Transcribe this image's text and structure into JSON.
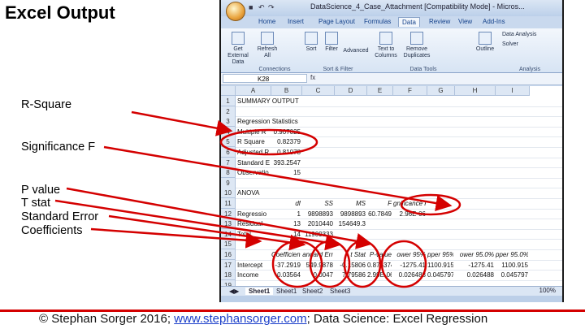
{
  "slide": {
    "title": "Excel Output",
    "labels": [
      "R-Square",
      "Significance F",
      "P value",
      "T stat",
      "Standard Error",
      "Coefficients"
    ],
    "footer_prefix": "© Stephan Sorger 2016; ",
    "footer_link": "www.stephansorger.com",
    "footer_suffix": "; Data Science: Excel Regression",
    "accent": "#d40000"
  },
  "excel": {
    "window_title": "DataScience_4_Case_Attachment [Compatibility Mode] - Micros...",
    "tabs": [
      "Home",
      "Insert",
      "Page Layout",
      "Formulas",
      "Data",
      "Review",
      "View",
      "Add-Ins"
    ],
    "active_tab": "Data",
    "ribbon": {
      "buttons": [
        "Get External Data",
        "Refresh All",
        "Sort",
        "Filter",
        "Advanced",
        "Text to Columns",
        "Remove Duplicates",
        "Outline",
        "Data Analysis",
        "Solver"
      ],
      "groups": [
        "Connections",
        "Sort & Filter",
        "Data Tools",
        "Analysis"
      ]
    },
    "name_box": "K28",
    "fx": "fx",
    "columns": [
      "A",
      "B",
      "C",
      "D",
      "E",
      "F",
      "G",
      "H",
      "I"
    ],
    "rows": [
      "1",
      "2",
      "3",
      "4",
      "5",
      "6",
      "7",
      "8",
      "9",
      "10",
      "11",
      "12",
      "13",
      "14",
      "15",
      "16",
      "17",
      "18",
      "19"
    ],
    "summary": {
      "title": "SUMMARY OUTPUT",
      "reg_stats": "Regression Statistics",
      "stats": [
        {
          "label": "Multiple R",
          "value": "0.907025"
        },
        {
          "label": "R Square",
          "value": "0.82379"
        },
        {
          "label": "Adjusted R",
          "value": "0.81078"
        },
        {
          "label": "Standard E",
          "value": "393.2547"
        },
        {
          "label": "Observatio",
          "value": "15"
        }
      ]
    },
    "anova": {
      "title": "ANOVA",
      "headers": [
        "df",
        "SS",
        "MS",
        "F",
        "gnificance F"
      ],
      "rows": [
        {
          "label": "Regressio",
          "df": "1",
          "ss": "9898893",
          "ms": "9898893",
          "f": "60.7849",
          "sig": "2.96E-06"
        },
        {
          "label": "Residual",
          "df": "13",
          "ss": "2010440",
          "ms": "154649.3",
          "f": "",
          "sig": ""
        },
        {
          "label": "Total",
          "df": "14",
          "ss": "11909333",
          "ms": "",
          "f": "",
          "sig": ""
        }
      ]
    },
    "coef": {
      "headers": [
        "Coefficients",
        "andard Err",
        "t Stat",
        "P-value",
        "ower 95%",
        "pper 95%",
        "ower 95.0%",
        "pper 95.0%"
      ],
      "rows": [
        {
          "label": "Intercept",
          "vals": [
            "-37.2919",
            "549.9878",
            "-0.15806",
            "0.876374",
            "-1275.41",
            "1100.915",
            "-1275.41",
            "1100.915"
          ]
        },
        {
          "label": "Income",
          "vals": [
            "0.03564",
            "0.0047",
            "7.79586",
            "2.99E-06",
            "0.026488",
            "0.045797",
            "0.026488",
            "0.045797"
          ]
        }
      ]
    },
    "sheets": [
      "Sheet1",
      "Sheet1",
      "Sheet2",
      "Sheet3"
    ],
    "zoom": "100%"
  }
}
